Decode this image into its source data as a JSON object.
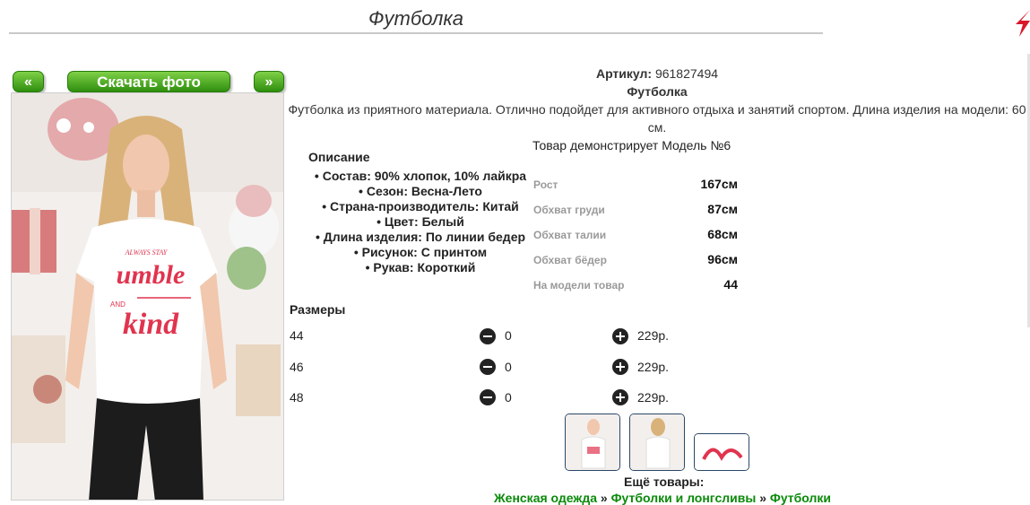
{
  "page": {
    "title": "Футболка"
  },
  "gallery": {
    "prev_label": "«",
    "download_label": "Скачать фото",
    "next_label": "»",
    "tshirt_print": {
      "top": "ALWAYS STAY",
      "main1": "umble",
      "and": "AND",
      "main2": "kind"
    }
  },
  "product": {
    "article_label": "Артикул:",
    "article_value": "961827494",
    "name": "Футболка",
    "description": "Футболка из приятного материала. Отлично подойдет для активного отдыха и занятий спортом. Длина изделия на модели: 60 см.",
    "model_note": "Товар демонстрирует Модель №6",
    "desc_heading": "Описание",
    "features": [
      "Состав: 90% хлопок, 10% лайкра",
      "Сезон: Весна-Лето",
      "Страна-производитель: Китай",
      "Цвет: Белый",
      "Длина изделия: По линии бедер",
      "Рисунок: С принтом",
      "Рукав: Короткий"
    ],
    "measurements": [
      {
        "label": "Рост",
        "value": "167см"
      },
      {
        "label": "Обхват груди",
        "value": "87см"
      },
      {
        "label": "Обхват талии",
        "value": "68см"
      },
      {
        "label": "Обхват бёдер",
        "value": "96см"
      },
      {
        "label": "На модели товар",
        "value": "44"
      }
    ]
  },
  "sizes": {
    "heading": "Размеры",
    "rows": [
      {
        "size": "44",
        "qty": "0",
        "price": "229р."
      },
      {
        "size": "46",
        "qty": "0",
        "price": "229р."
      },
      {
        "size": "48",
        "qty": "0",
        "price": "229р."
      }
    ]
  },
  "more": {
    "heading": "Ещё товары:",
    "crumbs": [
      "Женская одежда",
      "Футболки и лонгсливы",
      "Футболки"
    ],
    "separator": "»"
  },
  "colors": {
    "green": "#2f8f0e",
    "link_green": "#0a8a0a",
    "print_red": "#e0344f"
  }
}
